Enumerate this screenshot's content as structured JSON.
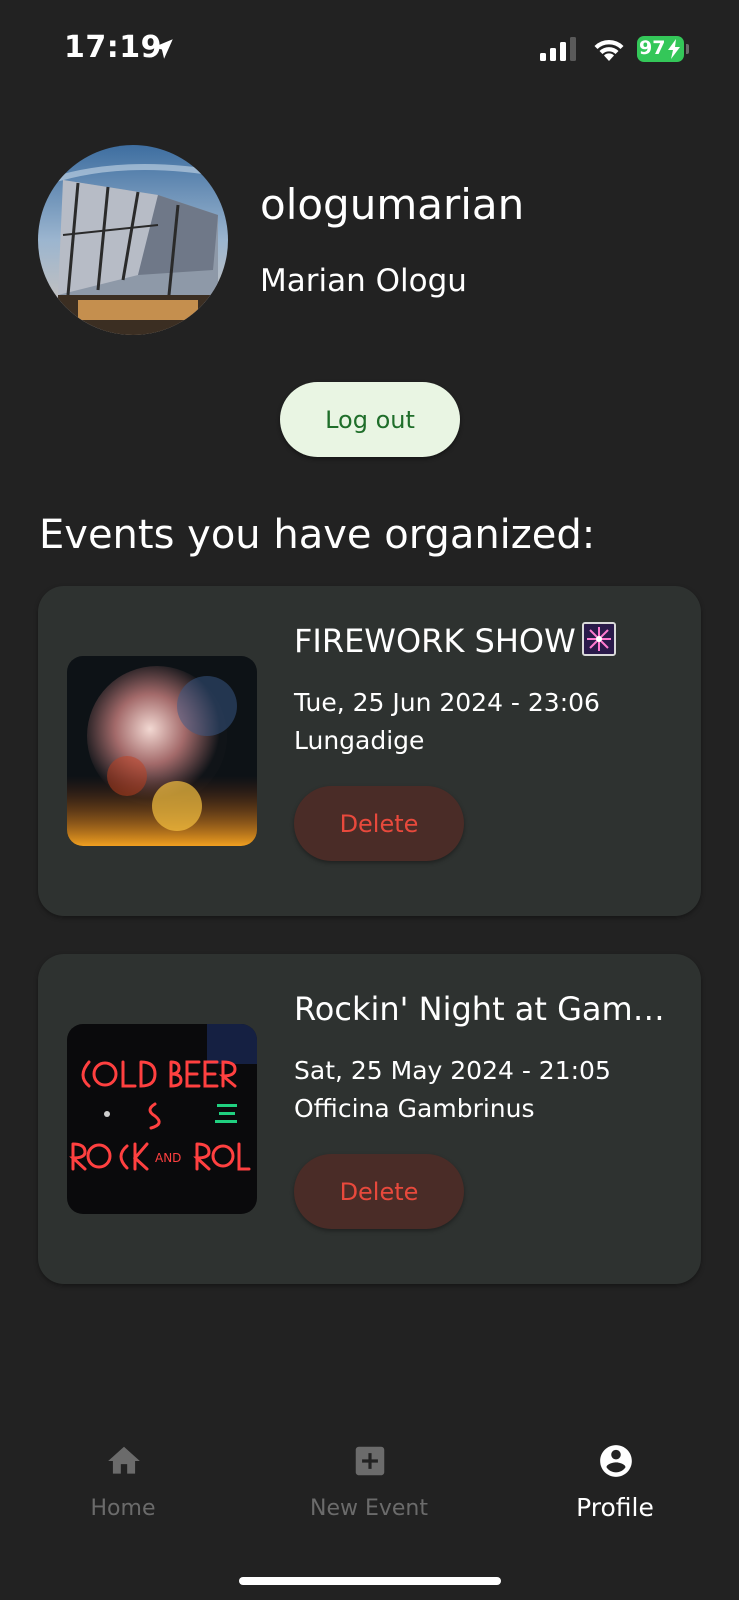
{
  "status_bar": {
    "time": "17:19",
    "battery": "97"
  },
  "profile": {
    "username": "ologumarian",
    "full_name": "Marian Ologu",
    "logout_label": "Log out"
  },
  "section_title": "Events you have organized:",
  "events": [
    {
      "title": "FIREWORK SHOW",
      "date": "Tue, 25 Jun 2024 - 23:06",
      "place": "Lungadige",
      "delete_label": "Delete"
    },
    {
      "title": "Rockin' Night at Gamb…",
      "date": "Sat, 25 May 2024 - 21:05",
      "place": "Officina Gambrinus",
      "delete_label": "Delete"
    }
  ],
  "nav": {
    "items": [
      {
        "label": "Home",
        "icon": "home-icon",
        "active": false
      },
      {
        "label": "New Event",
        "icon": "add-box-icon",
        "active": false
      },
      {
        "label": "Profile",
        "icon": "account-circle-icon",
        "active": true
      }
    ]
  },
  "colors": {
    "background": "#222222",
    "card": "#2e3230",
    "logout_bg": "#e9f5e3",
    "logout_text": "#1f6e2a",
    "delete_bg": "#4a2c27",
    "delete_text": "#e8493c",
    "battery": "#34c759"
  }
}
